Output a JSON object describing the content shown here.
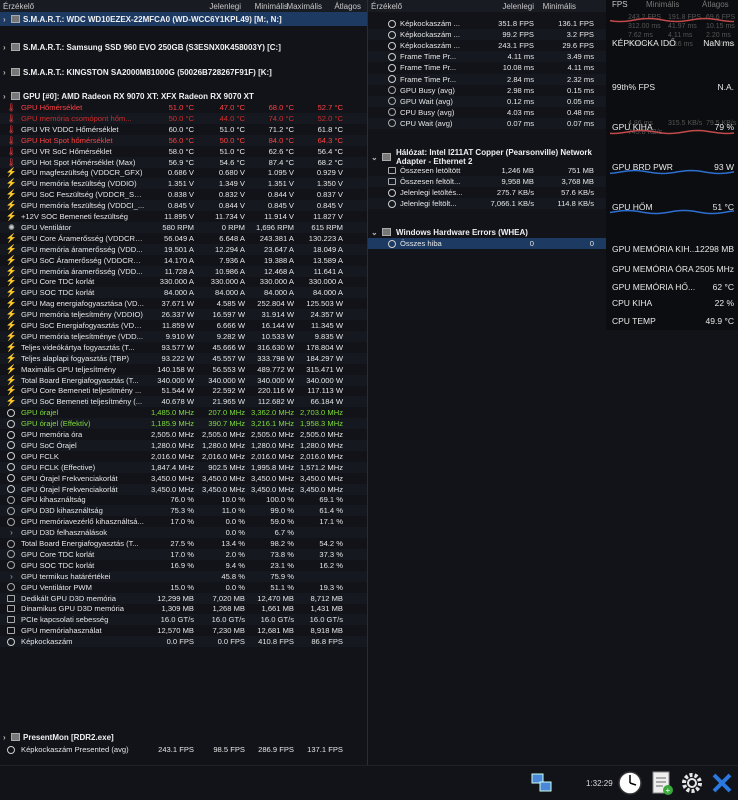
{
  "left_header": {
    "c0": "Érzékelő",
    "c1": "Jelenlegi",
    "c2": "Minimális",
    "c3": "Maximális",
    "c4": "Átlagos"
  },
  "right_header": {
    "c0": "Érzékelő",
    "c1": "Jelenlegi",
    "c2": "Minimális",
    "c3": "Maximális",
    "c4": "Átlagos"
  },
  "smart": [
    "S.M.A.R.T.: WDC WD10EZEX-22MFCA0 (WD-WCC6Y1KPL49) [M:, N:]",
    "S.M.A.R.T.: Samsung SSD 960 EVO 250GB (S3ESNX0K458003Y) [C:]",
    "S.M.A.R.T.: KINGSTON SA2000M81000G (50026B728267F91F) [K:]"
  ],
  "gpu_section": "GPU [#0]: AMD Radeon RX 9070 XT: XFX Radeon RX 9070 XT",
  "gpu_rows": [
    [
      "therm",
      "GPU Hőmérséklet",
      "51.0 °C",
      "47.0 °C",
      "68.0 °C",
      "52.7 °C",
      "red"
    ],
    [
      "therm",
      "GPU memória csomópont hőm...",
      "50.0 °C",
      "44.0 °C",
      "74.0 °C",
      "52.0 °C",
      "dred"
    ],
    [
      "therm",
      "GPU VR VDDC Hőmérséklet",
      "60.0 °C",
      "51.0 °C",
      "71.2 °C",
      "61.8 °C",
      ""
    ],
    [
      "therm",
      "GPU Hot Spot hőmérséklet",
      "56.0 °C",
      "50.0 °C",
      "84.0 °C",
      "64.3 °C",
      "red"
    ],
    [
      "therm",
      "GPU VR SoC Hőmérséklet",
      "58.0 °C",
      "51.0 °C",
      "62.6 °C",
      "56.4 °C",
      ""
    ],
    [
      "therm",
      "GPU Hot Spot Hőmérséklet (Max)",
      "56.9 °C",
      "54.6 °C",
      "87.4 °C",
      "68.2 °C",
      ""
    ],
    [
      "bolt",
      "GPU magfeszültség (VDDCR_GFX)",
      "0.686 V",
      "0.680 V",
      "1.095 V",
      "0.929 V",
      ""
    ],
    [
      "bolt",
      "GPU memória feszültség (VDDIO)",
      "1.351 V",
      "1.349 V",
      "1.351 V",
      "1.350 V",
      ""
    ],
    [
      "bolt",
      "GPU SoC Feszültség (VDDCR_SOC)",
      "0.838 V",
      "0.832 V",
      "0.844 V",
      "0.837 V",
      ""
    ],
    [
      "bolt",
      "GPU memória feszültség (VDDCI_...",
      "0.845 V",
      "0.844 V",
      "0.845 V",
      "0.845 V",
      ""
    ],
    [
      "bolt",
      "+12V SOC Bemeneti feszültség",
      "11.895 V",
      "11.734 V",
      "11.914 V",
      "11.827 V",
      ""
    ],
    [
      "fan",
      "GPU Ventilátor",
      "580 RPM",
      "0 RPM",
      "1,696 RPM",
      "615 RPM",
      ""
    ],
    [
      "bolt",
      "GPU Core Áramerősség (VDDCR_...",
      "56.049 A",
      "6.648 A",
      "243.381 A",
      "130.223 A",
      ""
    ],
    [
      "bolt",
      "GPU memória áramerősség (VDD...",
      "19.501 A",
      "12.294 A",
      "23.647 A",
      "18.049 A",
      ""
    ],
    [
      "bolt",
      "GPU SoC Áramerősség (VDDCR_S...",
      "14.170 A",
      "7.936 A",
      "19.388 A",
      "13.589 A",
      ""
    ],
    [
      "bolt",
      "GPU memória áramerősség (VDD...",
      "11.728 A",
      "10.986 A",
      "12.468 A",
      "11.641 A",
      ""
    ],
    [
      "bolt",
      "GPU Core TDC korlát",
      "330.000 A",
      "330.000 A",
      "330.000 A",
      "330.000 A",
      ""
    ],
    [
      "bolt",
      "GPU SOC TDC korlát",
      "84.000 A",
      "84.000 A",
      "84.000 A",
      "84.000 A",
      ""
    ],
    [
      "bolt",
      "GPU Mag energiafogyasztása (VD...",
      "37.671 W",
      "4.585 W",
      "252.804 W",
      "125.503 W",
      ""
    ],
    [
      "bolt",
      "GPU memória teljesítmény (VDDIO)",
      "26.337 W",
      "16.597 W",
      "31.914 W",
      "24.357 W",
      ""
    ],
    [
      "bolt",
      "GPU SoC Energiafogyasztás (VDD...",
      "11.859 W",
      "6.666 W",
      "16.144 W",
      "11.345 W",
      ""
    ],
    [
      "bolt",
      "GPU memória teljesítménye (VDD...",
      "9.910 W",
      "9.282 W",
      "10.533 W",
      "9.835 W",
      ""
    ],
    [
      "bolt",
      "Teljes videókártya fogyasztás (T...",
      "93.577 W",
      "45.666 W",
      "316.630 W",
      "178.804 W",
      ""
    ],
    [
      "bolt",
      "Teljes alaplapi fogyasztás (TBP)",
      "93.222 W",
      "45.557 W",
      "333.798 W",
      "184.297 W",
      ""
    ],
    [
      "bolt",
      "Maximális GPU teljesítmény",
      "140.158 W",
      "56.553 W",
      "489.772 W",
      "315.471 W",
      ""
    ],
    [
      "bolt",
      "Total Board Energiafogyasztás (T...",
      "340.000 W",
      "340.000 W",
      "340.000 W",
      "340.000 W",
      ""
    ],
    [
      "bolt",
      "GPU Core Bemeneti teljesítmény ...",
      "51.544 W",
      "22.592 W",
      "220.116 W",
      "117.113 W",
      ""
    ],
    [
      "bolt",
      "GPU SoC Bemeneti teljesítmény (...",
      "40.678 W",
      "21.965 W",
      "112.682 W",
      "66.184 W",
      ""
    ],
    [
      "clock",
      "GPU órajel",
      "1,485.0 MHz",
      "207.0 MHz",
      "3,362.0 MHz",
      "2,703.0 MHz",
      "grn"
    ],
    [
      "clock",
      "GPU órajel (Effektív)",
      "1,185.9 MHz",
      "390.7 MHz",
      "3,216.1 MHz",
      "1,958.3 MHz",
      "grn"
    ],
    [
      "clock",
      "GPU memória óra",
      "2,505.0 MHz",
      "2,505.0 MHz",
      "2,505.0 MHz",
      "2,505.0 MHz",
      ""
    ],
    [
      "clock",
      "GPU SoC Órajel",
      "1,280.0 MHz",
      "1,280.0 MHz",
      "1,280.0 MHz",
      "1,280.0 MHz",
      ""
    ],
    [
      "clock",
      "GPU FCLK",
      "2,016.0 MHz",
      "2,016.0 MHz",
      "2,016.0 MHz",
      "2,016.0 MHz",
      ""
    ],
    [
      "clock",
      "GPU FCLK (Effective)",
      "1,847.4 MHz",
      "902.5 MHz",
      "1,995.8 MHz",
      "1,571.2 MHz",
      ""
    ],
    [
      "clock",
      "GPU Órajel Frekvenciakorlát",
      "3,450.0 MHz",
      "3,450.0 MHz",
      "3,450.0 MHz",
      "3,450.0 MHz",
      ""
    ],
    [
      "clock",
      "GPU Órajel Frekvenciakorlát",
      "3,450.0 MHz",
      "3,450.0 MHz",
      "3,450.0 MHz",
      "3,450.0 MHz",
      ""
    ],
    [
      "gauge",
      "GPU kihasználtság",
      "76.0 %",
      "10.0 %",
      "100.0 %",
      "69.1 %",
      ""
    ],
    [
      "gauge",
      "GPU D3D kihasználtság",
      "75.3 %",
      "11.0 %",
      "99.0 %",
      "61.4 %",
      ""
    ],
    [
      "gauge",
      "GPU memóriavezérlő kihasználtsá...",
      "17.0 %",
      "0.0 %",
      "59.0 %",
      "17.1 %",
      ""
    ],
    [
      "chev",
      "GPU D3D felhasználások",
      "",
      "0.0 %",
      "6.7 %",
      "",
      ""
    ],
    [
      "gauge",
      "Total Board Energiafogyasztás (T...",
      "27.5 %",
      "13.4 %",
      "98.2 %",
      "54.2 %",
      ""
    ],
    [
      "gauge",
      "GPU Core TDC korlát",
      "17.0 %",
      "2.0 %",
      "73.8 %",
      "37.3 %",
      ""
    ],
    [
      "gauge",
      "GPU SOC TDC korlát",
      "16.9 %",
      "9.4 %",
      "23.1 %",
      "16.2 %",
      ""
    ],
    [
      "chev",
      "GPU termikus határértékei",
      "",
      "45.8 %",
      "75.9 %",
      "",
      ""
    ],
    [
      "gauge",
      "GPU Ventilátor PWM",
      "15.0 %",
      "0.0 %",
      "51.1 %",
      "19.3 %",
      ""
    ],
    [
      "db",
      "Dedikált GPU D3D memória",
      "12,299 MB",
      "7,020 MB",
      "12,470 MB",
      "8,712 MB",
      ""
    ],
    [
      "db",
      "Dinamikus GPU D3D memória",
      "1,309 MB",
      "1,268 MB",
      "1,661 MB",
      "1,431 MB",
      ""
    ],
    [
      "db",
      "PCIe kapcsolati sebesség",
      "16.0 GT/s",
      "16.0 GT/s",
      "16.0 GT/s",
      "16.0 GT/s",
      ""
    ],
    [
      "db",
      "GPU memóriahasználat",
      "12,570 MB",
      "7,230 MB",
      "12,681 MB",
      "8,918 MB",
      ""
    ],
    [
      "clock",
      "Képkockaszám",
      "0.0 FPS",
      "0.0 FPS",
      "410.8 FPS",
      "86.8 FPS",
      ""
    ]
  ],
  "presentmon_section": "PresentMon [RDR2.exe]",
  "presentmon_rows": [
    [
      "clock",
      "Képkockaszám Presented (avg)",
      "243.1 FPS",
      "98.5 FPS",
      "286.9 FPS",
      "137.1 FPS",
      ""
    ]
  ],
  "right_rows_top": [
    [
      "clock",
      "Képkockaszám ...",
      "351.8 FPS",
      "136.1 FPS"
    ],
    [
      "clock",
      "Képkockaszám ...",
      "99.2 FPS",
      "3.2 FPS"
    ],
    [
      "clock",
      "Képkockaszám ...",
      "243.1 FPS",
      "29.6 FPS"
    ],
    [
      "clock",
      "Frame Time Pr...",
      "4.11 ms",
      "3.49 ms"
    ],
    [
      "clock",
      "Frame Time Pr...",
      "10.08 ms",
      "4.11 ms"
    ],
    [
      "clock",
      "Frame Time Pr...",
      "2.84 ms",
      "2.32 ms"
    ],
    [
      "gauge",
      "GPU Busy (avg)",
      "2.98 ms",
      "0.15 ms"
    ],
    [
      "gauge",
      "GPU Wait (avg)",
      "0.12 ms",
      "0.05 ms"
    ],
    [
      "gauge",
      "CPU Busy (avg)",
      "4.03 ms",
      "0.48 ms"
    ],
    [
      "gauge",
      "CPU Wait (avg)",
      "0.07 ms",
      "0.07 ms"
    ]
  ],
  "network_section": "Hálózat: Intel I211AT Copper (Pearsonville) Network Adapter - Ethernet 2",
  "network_rows": [
    [
      "db",
      "Összesen letöltött",
      "1,246 MB",
      "751 MB"
    ],
    [
      "db",
      "Összesen feltölt...",
      "9,958 MB",
      "3,768 MB"
    ],
    [
      "clock",
      "Jelenlegi letöltés...",
      "275.7 KB/s",
      "57.6 KB/s"
    ],
    [
      "clock",
      "Jelenlegi feltölt...",
      "7,066.1 KB/s",
      "114.8 KB/s"
    ]
  ],
  "whea_section": "Windows Hardware Errors (WHEA)",
  "whea_rows": [
    [
      "clock",
      "Összes hiba",
      "0",
      "0"
    ]
  ],
  "overlay": {
    "fps_label": "FPS",
    "fps_value": "",
    "min_h": "Minimális",
    "avg_h": "Átlagos",
    "ghost_rows": [
      "243.2 FPS",
      "191.8 FPS",
      "69.6 FPS",
      "312.00 ms",
      "41.97 ms",
      "10.15 ms",
      "7.62 ms",
      "4.11 ms",
      "2.20 ms",
      "8.98 ms",
      "3.16 ms",
      "10.76 ms",
      "4.86 ms",
      "315.5 KB/s",
      "79.5 KB/s",
      "745.8 KB/s"
    ],
    "items": [
      {
        "label": "KÉPKOCKA IDŐ",
        "value": "NaN ms"
      },
      {
        "label": "99th% FPS",
        "value": "N.A."
      },
      {
        "label": "GPU KIHA",
        "value": "79 %"
      },
      {
        "label": "GPU BRD PWR",
        "value": "93 W"
      },
      {
        "label": "GPU HŐM",
        "value": "51 °C"
      },
      {
        "label": "GPU MEMÓRIA KIH...",
        "value": "12298 MB"
      },
      {
        "label": "GPU MEMÓRIA ÓRA",
        "value": "2505 MHz"
      },
      {
        "label": "GPU MEMÓRIA HŐ...",
        "value": "62 °C"
      },
      {
        "label": "CPU KIHA",
        "value": "22 %"
      },
      {
        "label": "CPU TEMP",
        "value": "49.9 °C"
      }
    ]
  },
  "taskbar": {
    "time": "1:32:29"
  }
}
